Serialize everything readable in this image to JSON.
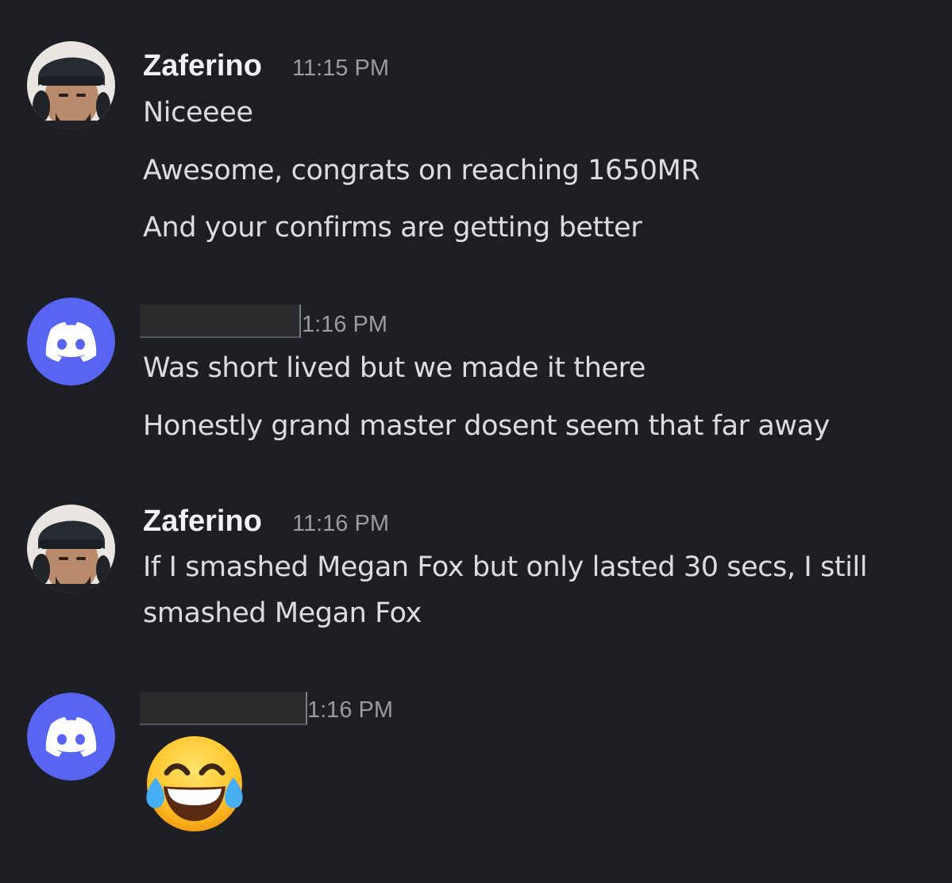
{
  "messages": [
    {
      "author": "Zaferino",
      "time": "11:15 PM",
      "lines": [
        "Niceeee",
        "Awesome, congrats on reaching 1650MR",
        "And your confirms are getting better"
      ]
    },
    {
      "author": "",
      "time": "1:16 PM",
      "lines": [
        "Was short lived but we made it there",
        "Honestly grand master dosent seem that far away"
      ]
    },
    {
      "author": "Zaferino",
      "time": "11:16 PM",
      "lines": [
        "If I smashed Megan Fox but only lasted 30 secs, I still smashed Megan Fox"
      ]
    },
    {
      "author": "",
      "time": "1:16 PM",
      "emoji": "face-with-tears-of-joy"
    }
  ],
  "colors": {
    "background": "#1e1f24",
    "discord_blurple": "#5865f2",
    "username": "#f2f3f5",
    "timestamp": "#9a9ca3",
    "message_text": "#dcdde1"
  },
  "icons": {
    "discord_avatar": "discord-logo-icon",
    "user_avatar": "profile-photo"
  }
}
